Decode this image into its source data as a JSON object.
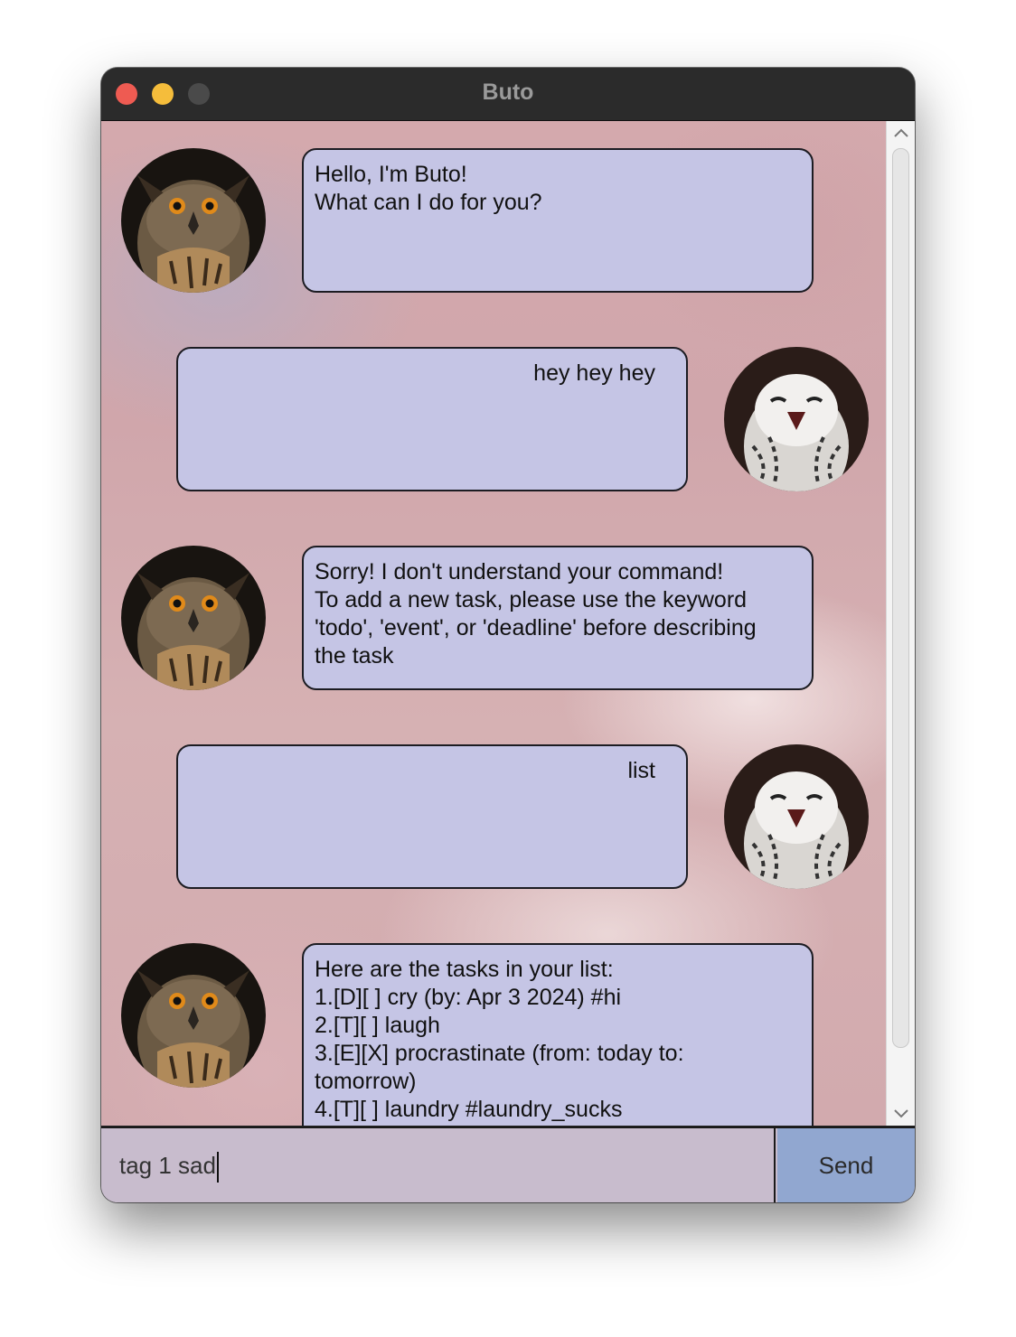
{
  "window": {
    "title": "Buto"
  },
  "messages": [
    {
      "sender": "bot",
      "text": "Hello, I'm Buto!\nWhat can I do for you?"
    },
    {
      "sender": "user",
      "text": "hey hey hey"
    },
    {
      "sender": "bot",
      "text": "Sorry! I don't understand your command!\nTo add a new task, please use the keyword\n'todo', 'event', or 'deadline' before describing\nthe task"
    },
    {
      "sender": "user",
      "text": "list"
    },
    {
      "sender": "bot",
      "text": "Here are the tasks in your list:\n1.[D][ ] cry (by: Apr 3 2024) #hi\n2.[T][ ] laugh\n3.[E][X] procrastinate (from: today to:\ntomorrow)\n4.[T][ ] laundry #laundry_sucks"
    }
  ],
  "input": {
    "value": "tag 1 sad"
  },
  "send_button": {
    "label": "Send"
  },
  "colors": {
    "bubble": "#c5c5e5",
    "input_bar": "#c8bccd",
    "send_button": "#91a7d0",
    "titlebar": "#2b2b2b"
  },
  "icons": {
    "bot_avatar": "horned-owl-icon",
    "user_avatar": "snowy-owl-icon"
  }
}
